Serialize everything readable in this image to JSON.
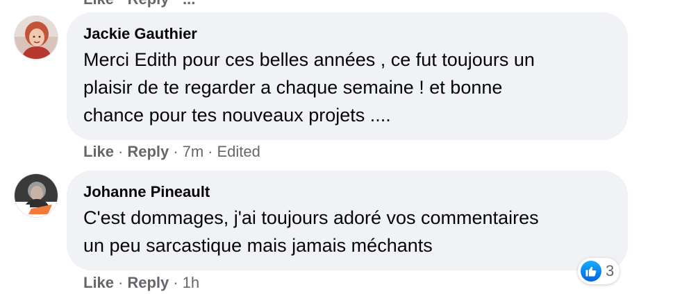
{
  "previous_comment": {
    "partial_actions": "Like · Reply · ..."
  },
  "comments": [
    {
      "author": "Jackie Gauthier",
      "text_lines": [
        "Merci Edith pour ces belles années , ce fut toujours un",
        "plaisir de te regarder a chaque semaine ! et bonne",
        "chance pour tes nouveaux projets ...."
      ],
      "like_label": "Like",
      "reply_label": "Reply",
      "time": "7m",
      "edited": "Edited",
      "separator": "·",
      "avatar_icon": "profile-photo-woman-red-hair"
    },
    {
      "author": "Johanne Pineault",
      "text_lines": [
        "C'est dommages, j'ai toujours adoré vos commentaires",
        "un peu sarcastique mais jamais méchants"
      ],
      "like_label": "Like",
      "reply_label": "Reply",
      "time": "1h",
      "separator": "·",
      "avatar_icon": "profile-photo-woman-gray-hair",
      "reactions": {
        "icon": "thumbs-up-icon",
        "count": "3",
        "color": "#1877f2"
      }
    }
  ],
  "colors": {
    "bubble": "#f0f2f5",
    "meta_text": "#65676b",
    "text": "#050505"
  }
}
